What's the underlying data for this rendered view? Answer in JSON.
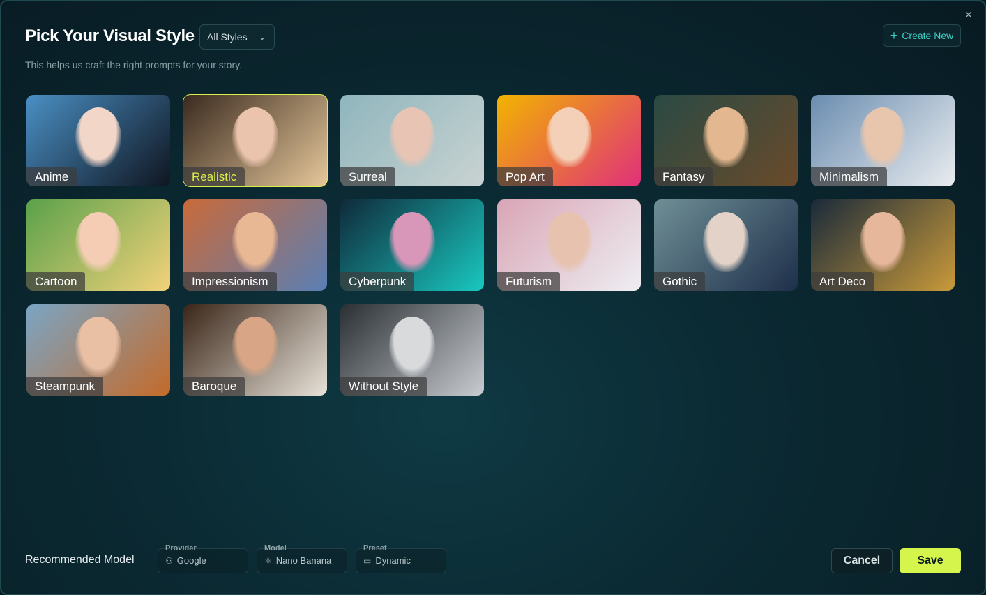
{
  "dialog": {
    "title": "Pick Your Visual Style",
    "subtitle": "This helps us craft the right prompts for your story.",
    "filter": {
      "selected": "All Styles"
    },
    "create_label": "Create New",
    "close_icon": "close-icon"
  },
  "styles": [
    {
      "label": "Anime",
      "selected": false,
      "colors": [
        "#4a8fc4",
        "#0f1520",
        "#f2d6c8"
      ]
    },
    {
      "label": "Realistic",
      "selected": true,
      "colors": [
        "#3a2a1f",
        "#e6c79a",
        "#eac4ad"
      ]
    },
    {
      "label": "Surreal",
      "selected": false,
      "colors": [
        "#8fb5bd",
        "#c9d3d1",
        "#e8c4b4"
      ]
    },
    {
      "label": "Pop Art",
      "selected": false,
      "colors": [
        "#f2b400",
        "#e0307a",
        "#f5d0b8"
      ]
    },
    {
      "label": "Fantasy",
      "selected": false,
      "colors": [
        "#2a4a44",
        "#6a4a2a",
        "#e3b890"
      ]
    },
    {
      "label": "Minimalism",
      "selected": false,
      "colors": [
        "#6b8db0",
        "#e9ecef",
        "#e8c6ae"
      ]
    },
    {
      "label": "Cartoon",
      "selected": false,
      "colors": [
        "#5aa14a",
        "#f2d27a",
        "#f5cdb5"
      ]
    },
    {
      "label": "Impressionism",
      "selected": false,
      "colors": [
        "#c96a3a",
        "#5a7fb5",
        "#e8b894"
      ]
    },
    {
      "label": "Cyberpunk",
      "selected": false,
      "colors": [
        "#0f2a3a",
        "#19c8c0",
        "#d896b8"
      ]
    },
    {
      "label": "Futurism",
      "selected": false,
      "colors": [
        "#d9a5b6",
        "#eeeef2",
        "#e7c2ae"
      ]
    },
    {
      "label": "Gothic",
      "selected": false,
      "colors": [
        "#6f8f96",
        "#1e2f4a",
        "#e2d2c8"
      ]
    },
    {
      "label": "Art Deco",
      "selected": false,
      "colors": [
        "#1a2a3a",
        "#c99a3a",
        "#e6b79a"
      ]
    },
    {
      "label": "Steampunk",
      "selected": false,
      "colors": [
        "#7aa5c4",
        "#c46a2a",
        "#eac0a4"
      ]
    },
    {
      "label": "Baroque",
      "selected": false,
      "colors": [
        "#3a2618",
        "#e8e2d8",
        "#d8a686"
      ]
    },
    {
      "label": "Without Style",
      "selected": false,
      "colors": [
        "#2a2f33",
        "#c8ccd0",
        "#d8dadc"
      ]
    }
  ],
  "footer": {
    "recommended_label": "Recommended Model",
    "fields": [
      {
        "caption": "Provider",
        "value": "Google",
        "icon": "user-icon"
      },
      {
        "caption": "Model",
        "value": "Nano Banana",
        "icon": "model-icon"
      },
      {
        "caption": "Preset",
        "value": "Dynamic",
        "icon": "preset-icon"
      }
    ],
    "cancel_label": "Cancel",
    "save_label": "Save"
  },
  "colors": {
    "accent": "#d6f54c",
    "link": "#3fd1c8"
  }
}
